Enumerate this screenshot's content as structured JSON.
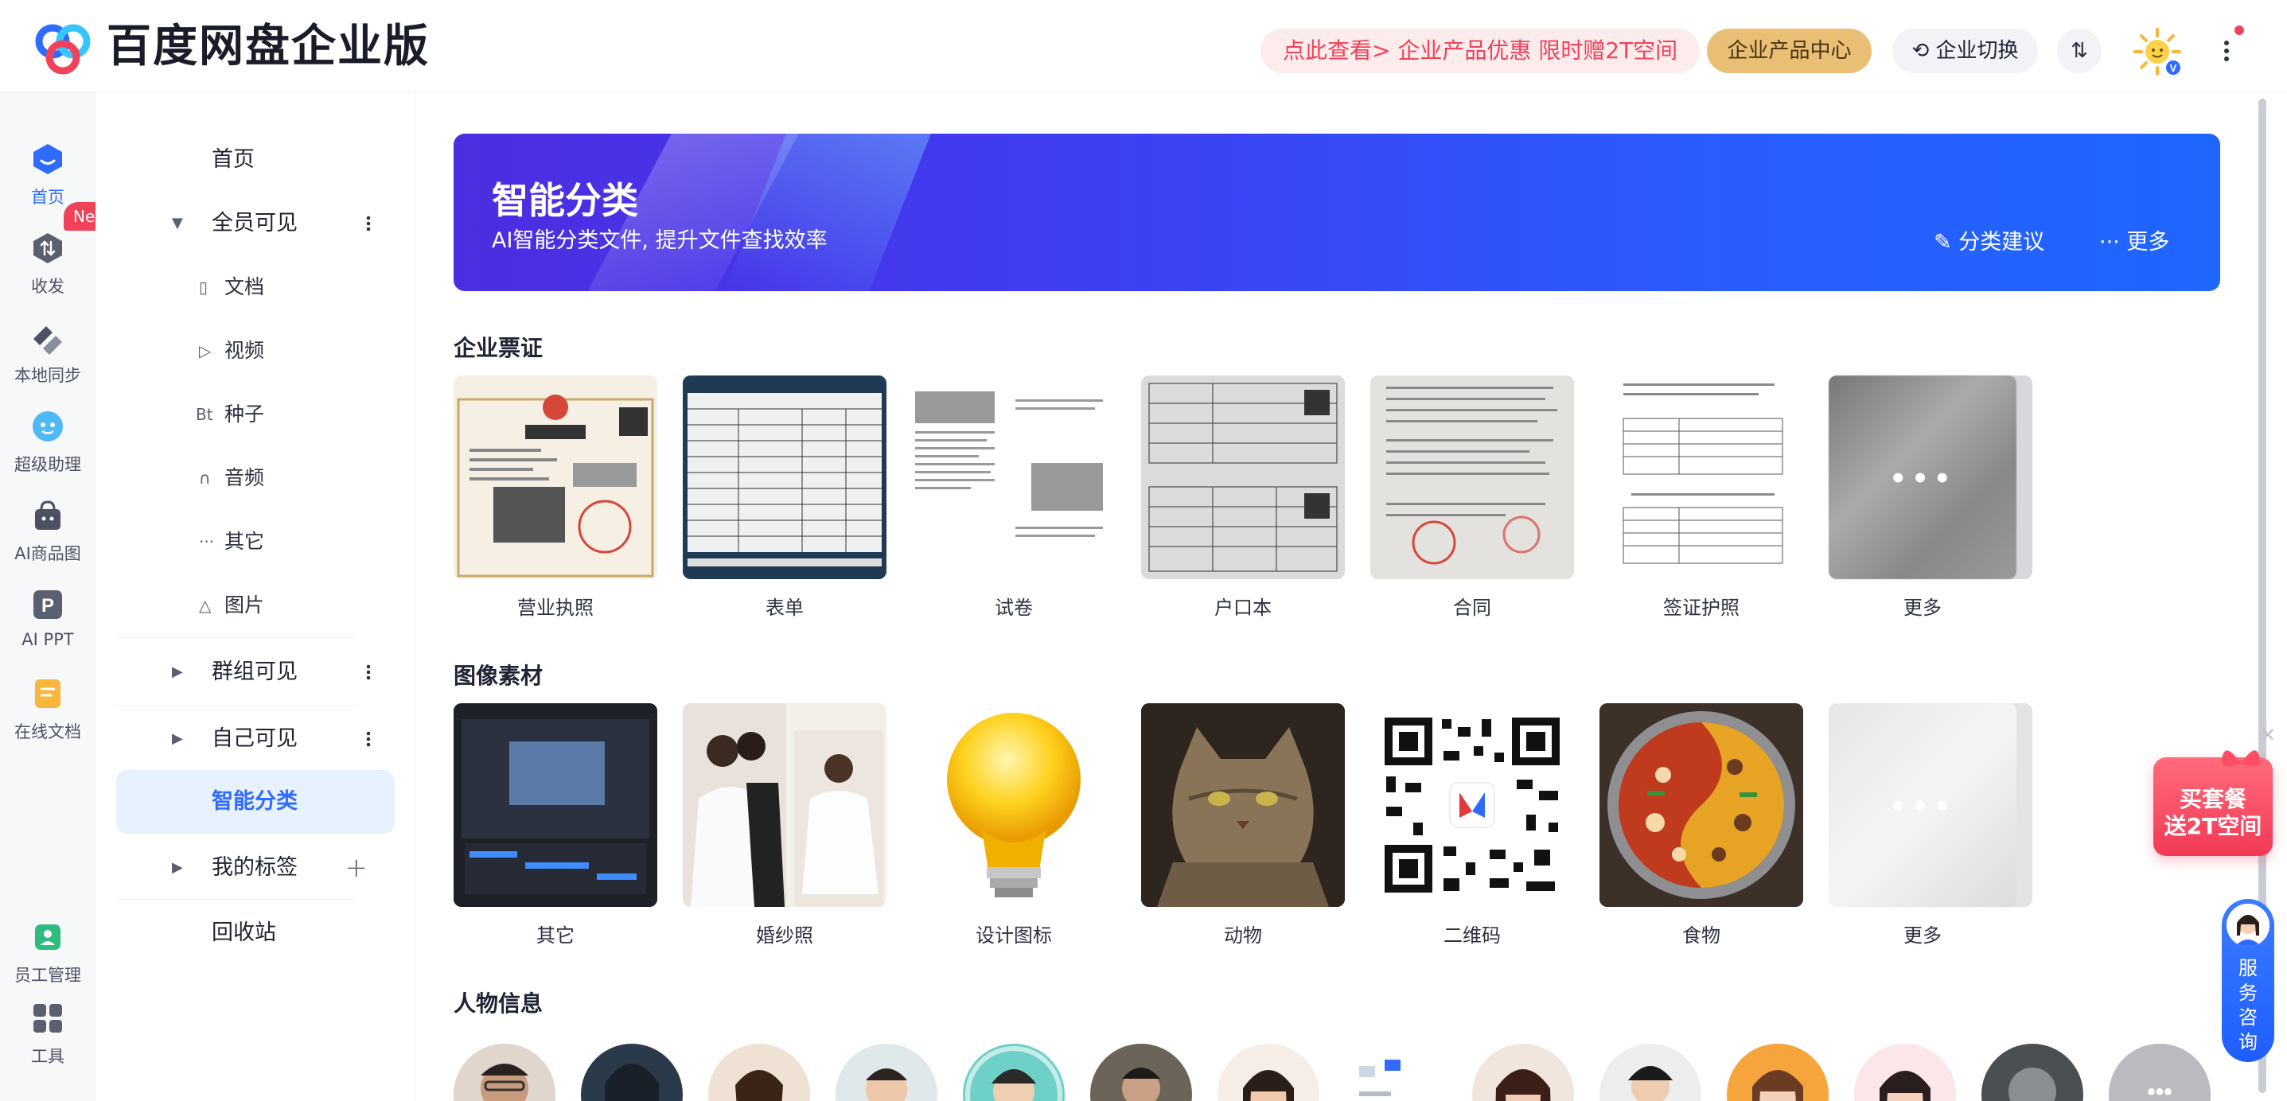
{
  "app": {
    "brand": "百度网盘企业版",
    "promo": "点此查看> 企业产品优惠 限时赠2T空间",
    "product_center": "企业产品中心",
    "switch_label": "企业切换",
    "transfer_label": "⇅"
  },
  "rail": {
    "items": [
      {
        "label": "首页",
        "icon": "home-icon"
      },
      {
        "label": "收发",
        "icon": "transfer-icon"
      },
      {
        "label": "本地同步",
        "icon": "sync-icon"
      },
      {
        "label": "超级助理",
        "icon": "assistant-icon"
      },
      {
        "label": "AI商品图",
        "icon": "ai-product-icon"
      },
      {
        "label": "AI PPT",
        "icon": "ppt-icon"
      },
      {
        "label": "在线文档",
        "icon": "online-doc-icon"
      },
      {
        "label": "员工管理",
        "icon": "staff-icon"
      },
      {
        "label": "工具",
        "icon": "tools-icon"
      }
    ],
    "new_badge": "New"
  },
  "tree": {
    "home": "首页",
    "all_visible": "全员可见",
    "docs": "文档",
    "video": "视频",
    "seed_icon": "Bt",
    "seed": "种子",
    "audio": "音频",
    "other_icon": "···",
    "other": "其它",
    "image": "图片",
    "group_visible": "群组可见",
    "self_visible": "自己可见",
    "smart_category": "智能分类",
    "my_tags": "我的标签",
    "recycle": "回收站"
  },
  "banner": {
    "title": "智能分类",
    "subtitle": "AI智能分类文件, 提升文件查找效率",
    "suggest": "分类建议",
    "more": "··· 更多"
  },
  "sections": {
    "certs": {
      "title": "企业票证",
      "items": [
        "营业执照",
        "表单",
        "试卷",
        "户口本",
        "合同",
        "签证护照",
        "更多"
      ]
    },
    "images": {
      "title": "图像素材",
      "items": [
        "其它",
        "婚纱照",
        "设计图标",
        "动物",
        "二维码",
        "食物",
        "更多"
      ]
    },
    "people": {
      "title": "人物信息"
    }
  },
  "widgets": {
    "gift_line1": "买套餐",
    "gift_line2": "送2T空间",
    "service": "服务咨询"
  },
  "colors": {
    "accent": "#2f6bff",
    "promo": "#f0425a",
    "gold": "#e9bf75"
  }
}
